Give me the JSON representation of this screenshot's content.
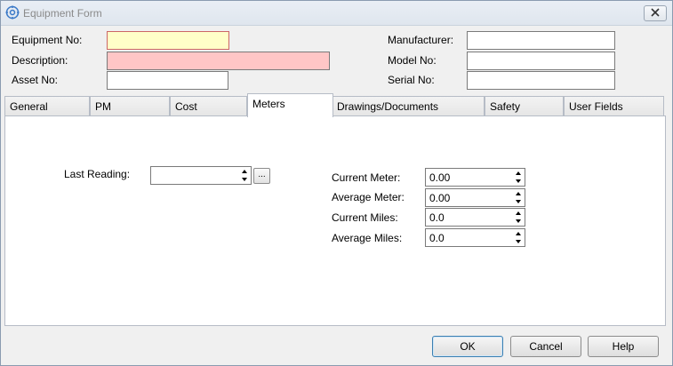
{
  "window": {
    "title": "Equipment Form",
    "icon": "gear-icon"
  },
  "header_fields": {
    "equipment_no": {
      "label": "Equipment No:",
      "value": ""
    },
    "description": {
      "label": "Description:",
      "value": ""
    },
    "asset_no": {
      "label": "Asset No:",
      "value": ""
    },
    "manufacturer": {
      "label": "Manufacturer:",
      "value": ""
    },
    "model_no": {
      "label": "Model No:",
      "value": ""
    },
    "serial_no": {
      "label": "Serial No:",
      "value": ""
    }
  },
  "tabs": [
    {
      "label": "General"
    },
    {
      "label": "PM"
    },
    {
      "label": "Cost"
    },
    {
      "label": "Meters",
      "active": true
    },
    {
      "label": "Drawings/Documents"
    },
    {
      "label": "Safety"
    },
    {
      "label": "User Fields"
    }
  ],
  "meters": {
    "last_reading": {
      "label": "Last Reading:",
      "value": ""
    },
    "browse_label": "...",
    "current_meter": {
      "label": "Current Meter:",
      "value": "0.00"
    },
    "average_meter": {
      "label": "Average Meter:",
      "value": "0.00"
    },
    "current_miles": {
      "label": "Current Miles:",
      "value": "0.0"
    },
    "average_miles": {
      "label": "Average Miles:",
      "value": "0.0"
    }
  },
  "buttons": {
    "ok": "OK",
    "cancel": "Cancel",
    "help": "Help"
  },
  "colors": {
    "required_yellow": "#ffffc8",
    "required_pink": "#ffc6c6",
    "focus_border": "#cc6666"
  }
}
